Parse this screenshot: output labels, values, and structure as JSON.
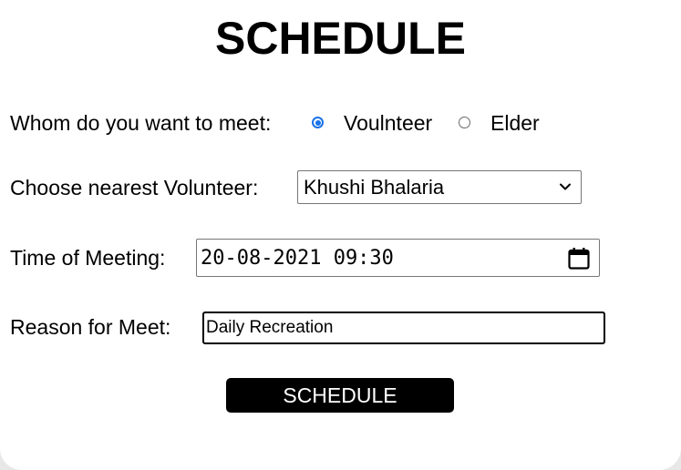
{
  "page": {
    "title": "SCHEDULE"
  },
  "meet_with": {
    "label": "Whom do you want to meet:",
    "options": [
      {
        "label": "Voulnteer",
        "selected": true
      },
      {
        "label": "Elder",
        "selected": false
      }
    ]
  },
  "volunteer": {
    "label": "Choose nearest Volunteer:",
    "selected_value": "Khushi Bhalaria",
    "icon": "chevron-down-icon"
  },
  "meeting_time": {
    "label": "Time of Meeting:",
    "value": "20-08-2021 09:30",
    "icon": "calendar-icon"
  },
  "reason": {
    "label": "Reason for Meet:",
    "value": "Daily Recreation"
  },
  "submit": {
    "label": "SCHEDULE"
  },
  "colors": {
    "accent": "#1a73e8",
    "button_bg": "#000000",
    "button_text": "#ffffff"
  }
}
